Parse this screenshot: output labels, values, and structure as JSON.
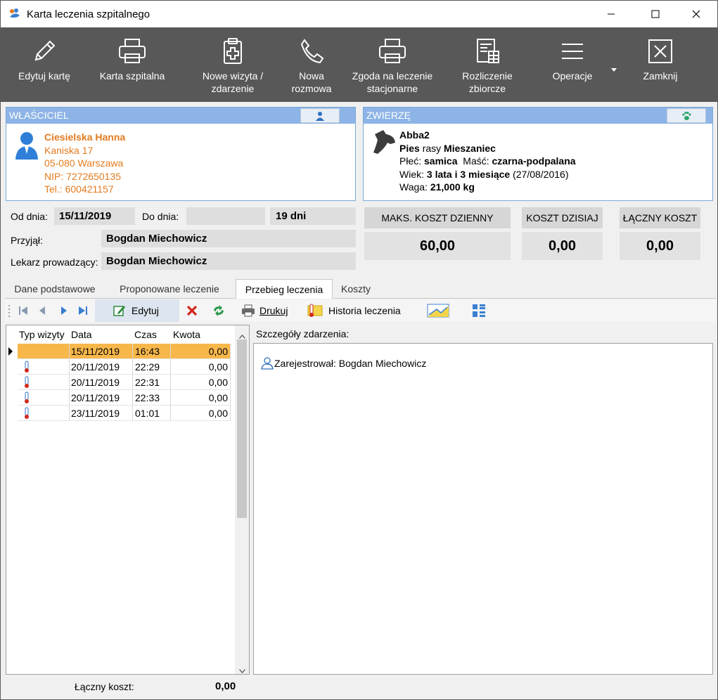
{
  "window": {
    "title": "Karta leczenia szpitalnego"
  },
  "toolbar": {
    "edit": "Edytuj kartę",
    "print_card": "Karta szpitalna",
    "new_visit": "Nowe wizyta /\nzdarzenie",
    "new_call": "Nowa\nrozmowa",
    "consent": "Zgoda na leczenie\nstacjonarne",
    "settlement": "Rozliczenie\nzbiorcze",
    "operations": "Operacje",
    "close": "Zamknij"
  },
  "owner": {
    "header": "WŁAŚCICIEL",
    "name": "Ciesielska Hanna",
    "street": "Kaniska 17",
    "city": "05-080  Warszawa",
    "nip": "NIP: 7272650135",
    "phone": "Tel.: 600421157"
  },
  "animal": {
    "header": "ZWIERZĘ",
    "name": "Abba2",
    "species": "Pies",
    "breed_label": " rasy ",
    "breed": "Mieszaniec",
    "sex_label": "Płeć: ",
    "sex": "samica",
    "color_label": "  Maść: ",
    "color": "czarna-podpalana",
    "age_label": "Wiek: ",
    "age": "3 lata i 3 miesiące",
    "birth": " (27/08/2016)",
    "weight_label": "Waga: ",
    "weight": "21,000 kg"
  },
  "fields": {
    "from_label": "Od dnia:",
    "from_value": "15/11/2019",
    "to_label": "Do dnia:",
    "to_value": "",
    "days": "19 dni",
    "received_label": "Przyjął:",
    "received_value": "Bogdan Miechowicz",
    "doctor_label": "Lekarz prowadzący:",
    "doctor_value": "Bogdan Miechowicz"
  },
  "costs": {
    "max_daily_label": "MAKS. KOSZT DZIENNY",
    "max_daily": "60,00",
    "today_label": "KOSZT DZISIAJ",
    "today": "0,00",
    "total_label": "ŁĄCZNY KOSZT",
    "total": "0,00"
  },
  "tabs": [
    "Dane podstawowe",
    "Proponowane leczenie",
    "Przebieg leczenia",
    "Koszty"
  ],
  "subtoolbar": {
    "edit": "Edytuj",
    "print": "Drukuj",
    "history": "Historia leczenia"
  },
  "grid": {
    "headers": [
      "Typ wizyty",
      "Data",
      "Czas",
      "Kwota"
    ],
    "rows": [
      {
        "date": "15/11/2019",
        "time": "16:43",
        "amount": "0,00"
      },
      {
        "date": "20/11/2019",
        "time": "22:29",
        "amount": "0,00"
      },
      {
        "date": "20/11/2019",
        "time": "22:31",
        "amount": "0,00"
      },
      {
        "date": "20/11/2019",
        "time": "22:33",
        "amount": "0,00"
      },
      {
        "date": "23/11/2019",
        "time": "01:01",
        "amount": "0,00"
      }
    ]
  },
  "details": {
    "label": "Szczegóły zdarzenia:",
    "registered": "Zarejestrował: Bogdan Miechowicz"
  },
  "footer": {
    "total_label": "Łączny koszt:",
    "total_value": "0,00"
  },
  "colors": {
    "toolbar_bg": "#585858",
    "panel_header": "#8db4e6",
    "owner_text": "#e37a1e",
    "selected_row": "#f7b74b"
  }
}
